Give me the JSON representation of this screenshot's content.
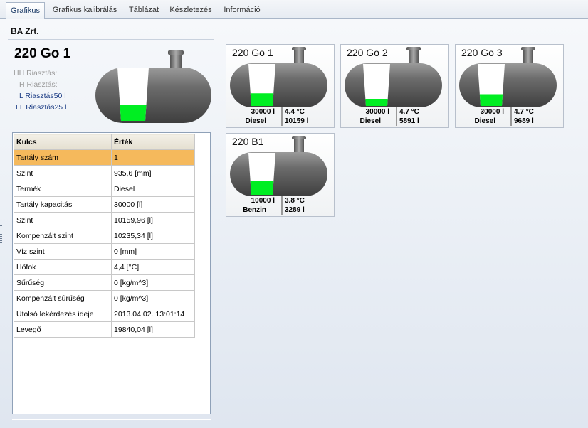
{
  "tabs": [
    "Grafikus",
    "Grafikus kalibrálás",
    "Táblázat",
    "Készletezés",
    "Információ"
  ],
  "company": "BA Zrt.",
  "selected_tank": {
    "name": "220 Go 1",
    "fill_fraction": 0.3,
    "alarms": {
      "hh": "HH Riasztás:",
      "h": "H Riasztás:",
      "l": "L Riasztás50 l",
      "ll": "LL Riasztás25 l"
    }
  },
  "table": {
    "headers": [
      "Kulcs",
      "Érték"
    ],
    "rows": [
      [
        "Tartály szám",
        "1"
      ],
      [
        "Szint",
        "935,6 [mm]"
      ],
      [
        "Termék",
        "Diesel"
      ],
      [
        "Tartály kapacitás",
        "30000 [l]"
      ],
      [
        "Szint",
        "10159,96 [l]"
      ],
      [
        "Kompenzált szint",
        "10235,34 [l]"
      ],
      [
        "Víz szint",
        "0 [mm]"
      ],
      [
        "Hőfok",
        "4,4 [°C]"
      ],
      [
        "Sűrűség",
        "0 [kg/m^3]"
      ],
      [
        "Kompenzált sűrűség",
        "0 [kg/m^3]"
      ],
      [
        "Utolsó lekérdezés ideje",
        "2013.04.02. 13:01:14"
      ],
      [
        "Levegő",
        "19840,04 [l]"
      ]
    ],
    "selected_row": 0
  },
  "tanks": [
    {
      "name": "220 Go 1",
      "capacity": "30000 l",
      "product": "Diesel",
      "temp": "4.4 °C",
      "volume": "10159 l",
      "fill_fraction": 0.3
    },
    {
      "name": "220 Go 2",
      "capacity": "30000 l",
      "product": "Diesel",
      "temp": "4.7 °C",
      "volume": "5891 l",
      "fill_fraction": 0.17
    },
    {
      "name": "220 Go 3",
      "capacity": "30000 l",
      "product": "Diesel",
      "temp": "4.7 °C",
      "volume": "9689 l",
      "fill_fraction": 0.28
    },
    {
      "name": "220 B1",
      "capacity": "10000 l",
      "product": "Benzin",
      "temp": "3.8 °C",
      "volume": "3289 l",
      "fill_fraction": 0.33
    }
  ],
  "colors": {
    "fill": "#00ee22",
    "tank": "#707070",
    "selected_row": "#f5b95c"
  }
}
